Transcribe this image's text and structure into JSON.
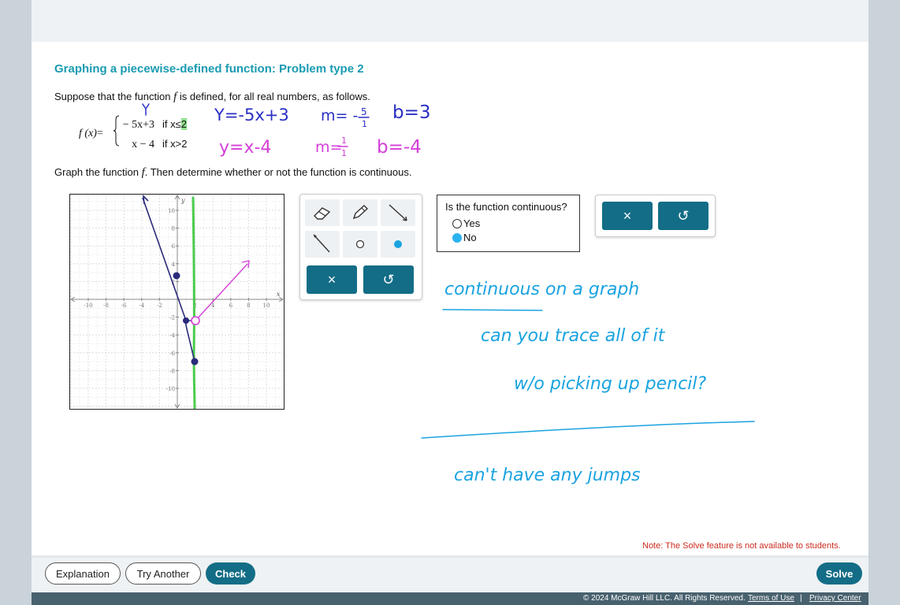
{
  "problem": {
    "title": "Graphing a piecewise-defined function: Problem type 2",
    "intro_before": "Suppose that the function ",
    "intro_var": "f",
    "intro_after": " is defined, for all real numbers, as follows.",
    "fx_label": "f (x)",
    "fx_eq": "=",
    "pieces": [
      {
        "expr": "− 5x+3",
        "cond_prefix": "if x≤",
        "cond_value": "2"
      },
      {
        "expr": "x − 4",
        "cond_prefix": "if x>",
        "cond_value": "2"
      }
    ],
    "instruction_before": "Graph the function ",
    "instruction_var": "f",
    "instruction_after": ". Then determine whether or not the function is continuous."
  },
  "graph": {
    "x_label": "x",
    "y_label": "y",
    "x_ticks": [
      "-10",
      "-8",
      "-6",
      "-4",
      "-2",
      "2",
      "4",
      "6",
      "8",
      "10"
    ],
    "y_ticks": [
      "10",
      "8",
      "6",
      "4",
      "2",
      "-2",
      "-4",
      "-6",
      "-8",
      "-10"
    ]
  },
  "tools": {
    "icons": [
      "eraser-icon",
      "pencil-icon",
      "line-segment-icon",
      "ray-icon",
      "open-point-icon",
      "closed-point-icon"
    ],
    "clear_symbol": "×",
    "undo_symbol": "↺"
  },
  "continuity": {
    "question": "Is the function continuous?",
    "options": [
      {
        "label": "Yes",
        "selected": false
      },
      {
        "label": "No",
        "selected": true
      }
    ]
  },
  "clear_panel": {
    "clear_symbol": "×",
    "undo_symbol": "↺"
  },
  "handwriting": {
    "ink_colors": {
      "blue": "#2a2fc4",
      "magenta": "#d43fd8",
      "cyan": "#1aa3e0",
      "green": "#4ccc4c"
    },
    "annotations": [
      "Y",
      "Y = -5x+3",
      "m = -5/1",
      "b = 3",
      "y = x - 4",
      "m = 1/1",
      "b = -4",
      "continuous on a graph",
      "can you trace all of it",
      "w/o picking up pencil?",
      "can't have any jumps"
    ]
  },
  "note": "Note: The Solve feature is not available to students.",
  "buttons": {
    "explanation": "Explanation",
    "try_another": "Try Another",
    "check": "Check",
    "solve": "Solve"
  },
  "footer": {
    "copyright": "© 2024 McGraw Hill LLC. All Rights Reserved.",
    "terms": "Terms of Use",
    "separator": "|",
    "privacy": "Privacy Center"
  },
  "colors": {
    "title_teal": "#1a9bb1",
    "button_teal": "#136d86",
    "note_red": "#cc2b1f",
    "footer_bg": "#48616e",
    "radio_selected": "#2ab2ef"
  }
}
